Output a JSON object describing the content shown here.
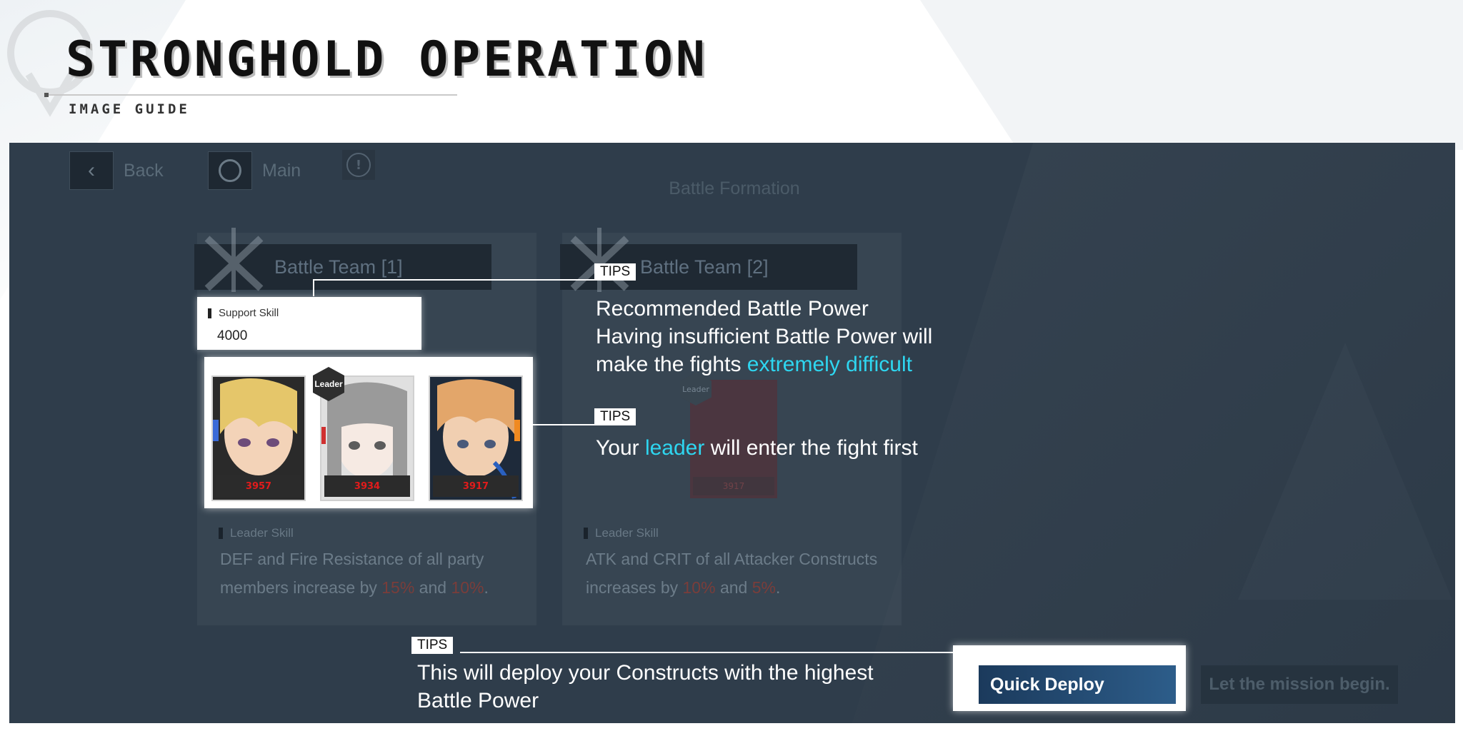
{
  "header": {
    "title": "STRONGHOLD OPERATION",
    "subtitle": "IMAGE GUIDE"
  },
  "game_ui": {
    "back_label": "Back",
    "main_label": "Main",
    "screen_title": "Battle Formation",
    "team1": {
      "title": "Battle Team [1]",
      "support_skill_label": "Support Skill",
      "support_skill_value": "4000",
      "leader_badge": "Leader",
      "characters": [
        {
          "power": "3957"
        },
        {
          "power": "3934"
        },
        {
          "power": "3917"
        }
      ],
      "leader_skill_label": "Leader Skill",
      "leader_skill_text_1": "DEF and Fire Resistance of all party",
      "leader_skill_text_2": "members increase by ",
      "leader_skill_pct_1": "15%",
      "leader_skill_and": " and ",
      "leader_skill_pct_2": "10%",
      "leader_skill_end": "."
    },
    "team2": {
      "title": "Battle Team [2]",
      "leader_badge": "Leader",
      "character_power": "3917",
      "leader_skill_label": "Leader Skill",
      "leader_skill_text_1": "ATK and CRIT of all Attacker Constructs",
      "leader_skill_text_2": "increases by ",
      "leader_skill_pct_1": "10%",
      "leader_skill_and": " and ",
      "leader_skill_pct_2": "5%",
      "leader_skill_end": "."
    },
    "quick_deploy_label": "Quick Deploy",
    "mission_begin_label": "Let the mission begin."
  },
  "tips": {
    "tag": "TIPS",
    "tip1_line1": "Recommended Battle Power",
    "tip1_line2": "Having insufficient Battle Power will",
    "tip1_line3_a": "make the fights ",
    "tip1_line3_hl": "extremely difficult",
    "tip2_a": "Your ",
    "tip2_hl": "leader",
    "tip2_b": " will enter the fight first",
    "tip3_line1": "This will deploy your Constructs with the highest",
    "tip3_line2": "Battle Power"
  },
  "colors": {
    "highlight": "#2ed6f0",
    "quick_deploy": "#1b3a5c",
    "percent": "#7a3d3a",
    "power_text": "#e21b1b"
  }
}
